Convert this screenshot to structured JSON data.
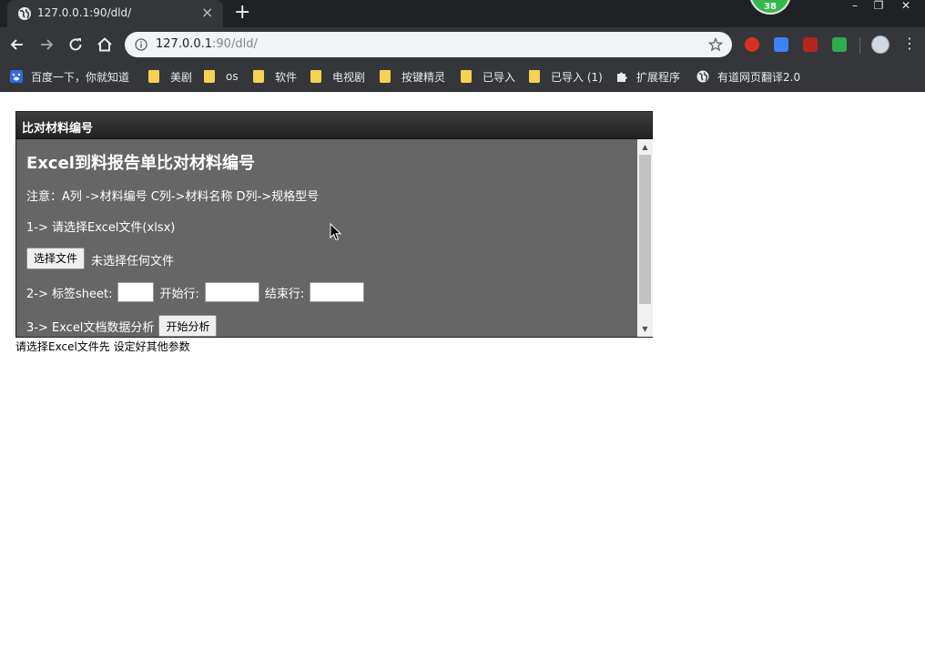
{
  "browser": {
    "tab_title": "127.0.0.1:90/dld/",
    "tab_close": "×",
    "new_tab": "+",
    "badge_count": "38",
    "url_host": "127.0.0.1",
    "url_rest": ":90/dld/",
    "window_controls": {
      "minimize": "–",
      "maximize": "❐",
      "close": "✕"
    },
    "menu": "⋮"
  },
  "extensions": [
    {
      "name": "yab-icon",
      "color": "#d93025"
    },
    {
      "name": "pen-icon",
      "color": "#3b82f6"
    },
    {
      "name": "speaker-icon",
      "color": "#b3261e"
    },
    {
      "name": "k-icon",
      "color": "#2eab4a"
    }
  ],
  "bookmarks": [
    {
      "label": "百度一下，你就知道",
      "icon": "baidu-icon"
    },
    {
      "label": "美剧",
      "icon": "folder-icon"
    },
    {
      "label": "os",
      "icon": "folder-icon"
    },
    {
      "label": "软件",
      "icon": "folder-icon"
    },
    {
      "label": "电视剧",
      "icon": "folder-icon"
    },
    {
      "label": "按键精灵",
      "icon": "folder-icon"
    },
    {
      "label": "已导入",
      "icon": "folder-icon"
    },
    {
      "label": "已导入 (1)",
      "icon": "folder-icon"
    },
    {
      "label": "扩展程序",
      "icon": "puzzle-icon"
    },
    {
      "label": "有道网页翻译2.0",
      "icon": "globe-icon"
    }
  ],
  "panel": {
    "header": "比对材料编号",
    "heading": "Excel到料报告单比对材料编号",
    "note": "注意：A列 ->材料编号 C列->材料名称 D列->规格型号",
    "step1": "1-> 请选择Excel文件(xlsx)",
    "file_button": "选择文件",
    "file_status": "未选择任何文件",
    "step2_label": "2-> 标签sheet:",
    "start_row_label": "开始行:",
    "end_row_label": "结束行:",
    "step3_label": "3-> Excel文档数据分析",
    "analyze_button": "开始分析"
  },
  "status_line": "请选择Excel文件先 设定好其他参数"
}
